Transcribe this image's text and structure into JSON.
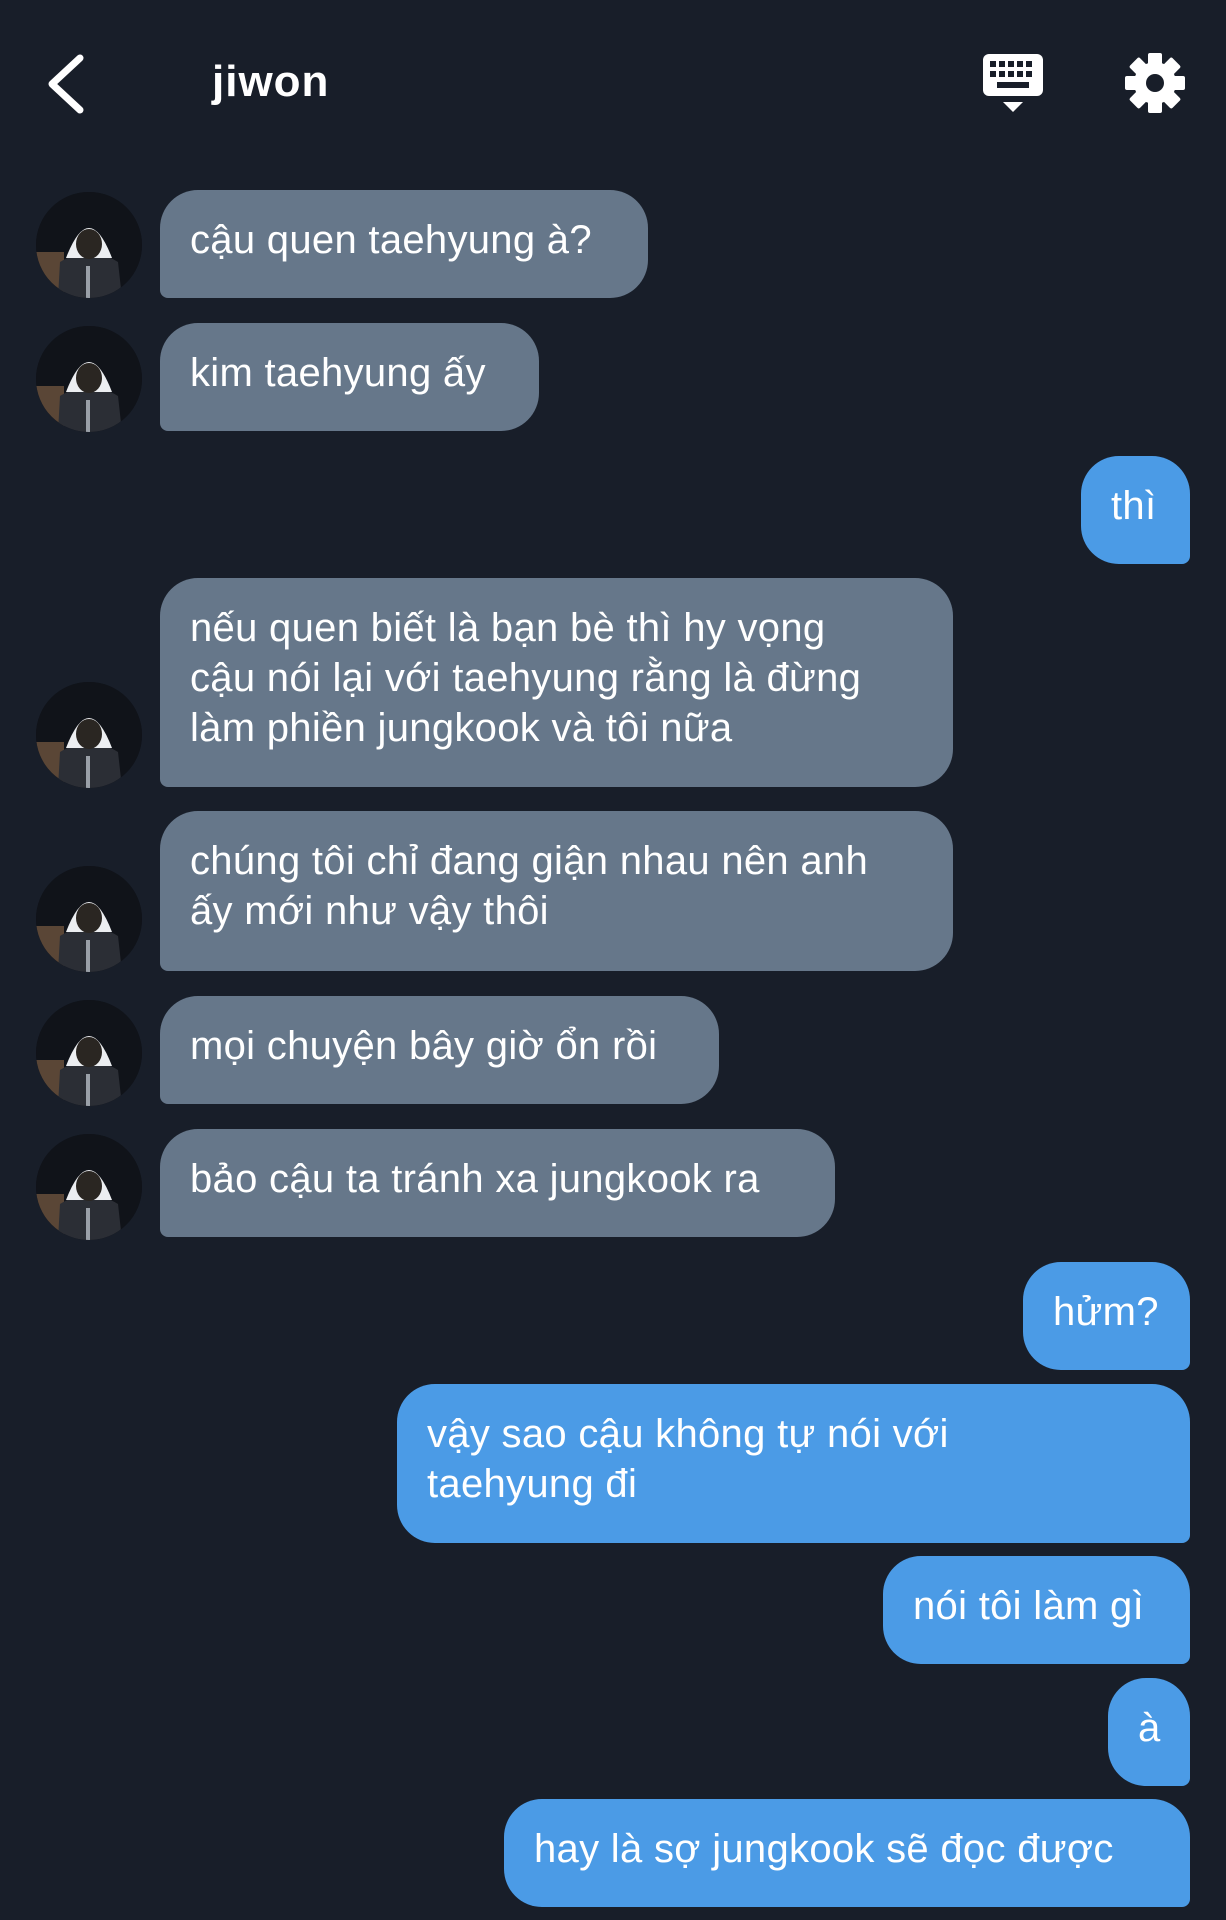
{
  "header": {
    "title": "jiwon",
    "back_icon": "chevron-left-icon",
    "keyboard_icon": "keyboard-icon",
    "settings_icon": "gear-icon"
  },
  "colors": {
    "background": "#181e29",
    "incoming_bubble": "#66778a",
    "outgoing_bubble": "#4b9be6",
    "text": "#ffffff"
  },
  "messages": [
    {
      "side": "incoming",
      "text": "cậu quen taehyung à?"
    },
    {
      "side": "incoming",
      "text": "kim taehyung ấy"
    },
    {
      "side": "outgoing",
      "text": "thì"
    },
    {
      "side": "incoming",
      "text": "nếu quen biết là bạn bè thì hy vọng\ncậu nói lại với taehyung rằng là đừng\nlàm phiền jungkook và tôi nữa"
    },
    {
      "side": "incoming",
      "text": "chúng tôi chỉ đang giận nhau nên anh\nấy mới như vậy thôi"
    },
    {
      "side": "incoming",
      "text": "mọi chuyện bây giờ ổn rồi"
    },
    {
      "side": "incoming",
      "text": "bảo cậu ta tránh xa jungkook ra"
    },
    {
      "side": "outgoing",
      "text": "hửm?"
    },
    {
      "side": "outgoing",
      "text": "vậy sao cậu không tự nói với\ntaehyung đi"
    },
    {
      "side": "outgoing",
      "text": "nói tôi làm gì"
    },
    {
      "side": "outgoing",
      "text": "à"
    },
    {
      "side": "outgoing",
      "text": "hay là sợ jungkook sẽ đọc được"
    }
  ]
}
